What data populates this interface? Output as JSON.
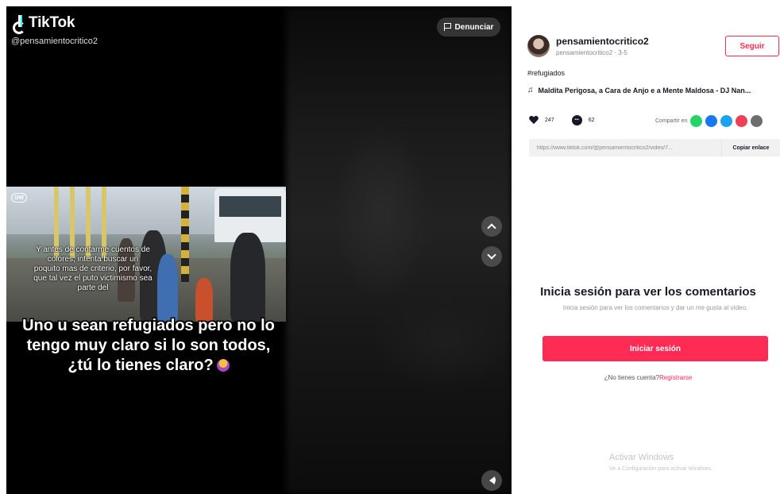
{
  "video": {
    "logo_text": "TikTok",
    "handle": "@pensamientocritico2",
    "report_label": "Denunciar",
    "frame_badge": "DW",
    "frame_caption": "Y antes de contarme cuentos de colores, intenta buscar un poquito mas de criterio, por favor, que tal vez el puto victimismo sea parte del",
    "overlay_text": "Uno u sean refugiados pero no lo tengo muy claro si lo son todos, ¿tú lo tienes claro?"
  },
  "side": {
    "username": "pensamientocritico2",
    "user_sub": "pensamientocritico2 · 3-5",
    "follow_label": "Seguir",
    "hashtag": "#refugiados",
    "music_icon": "♫",
    "music": "Maldita Perigosa, a Cara de Anjo e a Mente Maldosa - DJ Nan...",
    "likes": "247",
    "comments": "62",
    "share_label": "Compartir en",
    "link_url": "https://www.tiktok.com/@pensamientocritico2/video/7...",
    "copy_label": "Copiar enlace",
    "login_title": "Inicia sesión para ver los comentarios",
    "login_desc": "Inicia sesión para ver los comentarios y dar un me gusta al vídeo.",
    "login_button": "Iniciar sesión",
    "signup_prompt": "¿No tienes cuenta?",
    "signup_link": "Regístrarse",
    "windows_title": "Activar Windows",
    "windows_sub": "Ve a Configuración para activar Windows."
  },
  "colors": {
    "accent": "#fe2c55",
    "whatsapp": "#25d366",
    "facebook": "#1877f2",
    "twitter": "#1da1f2",
    "pocket": "#ef4056",
    "more": "#6e6e6e"
  }
}
